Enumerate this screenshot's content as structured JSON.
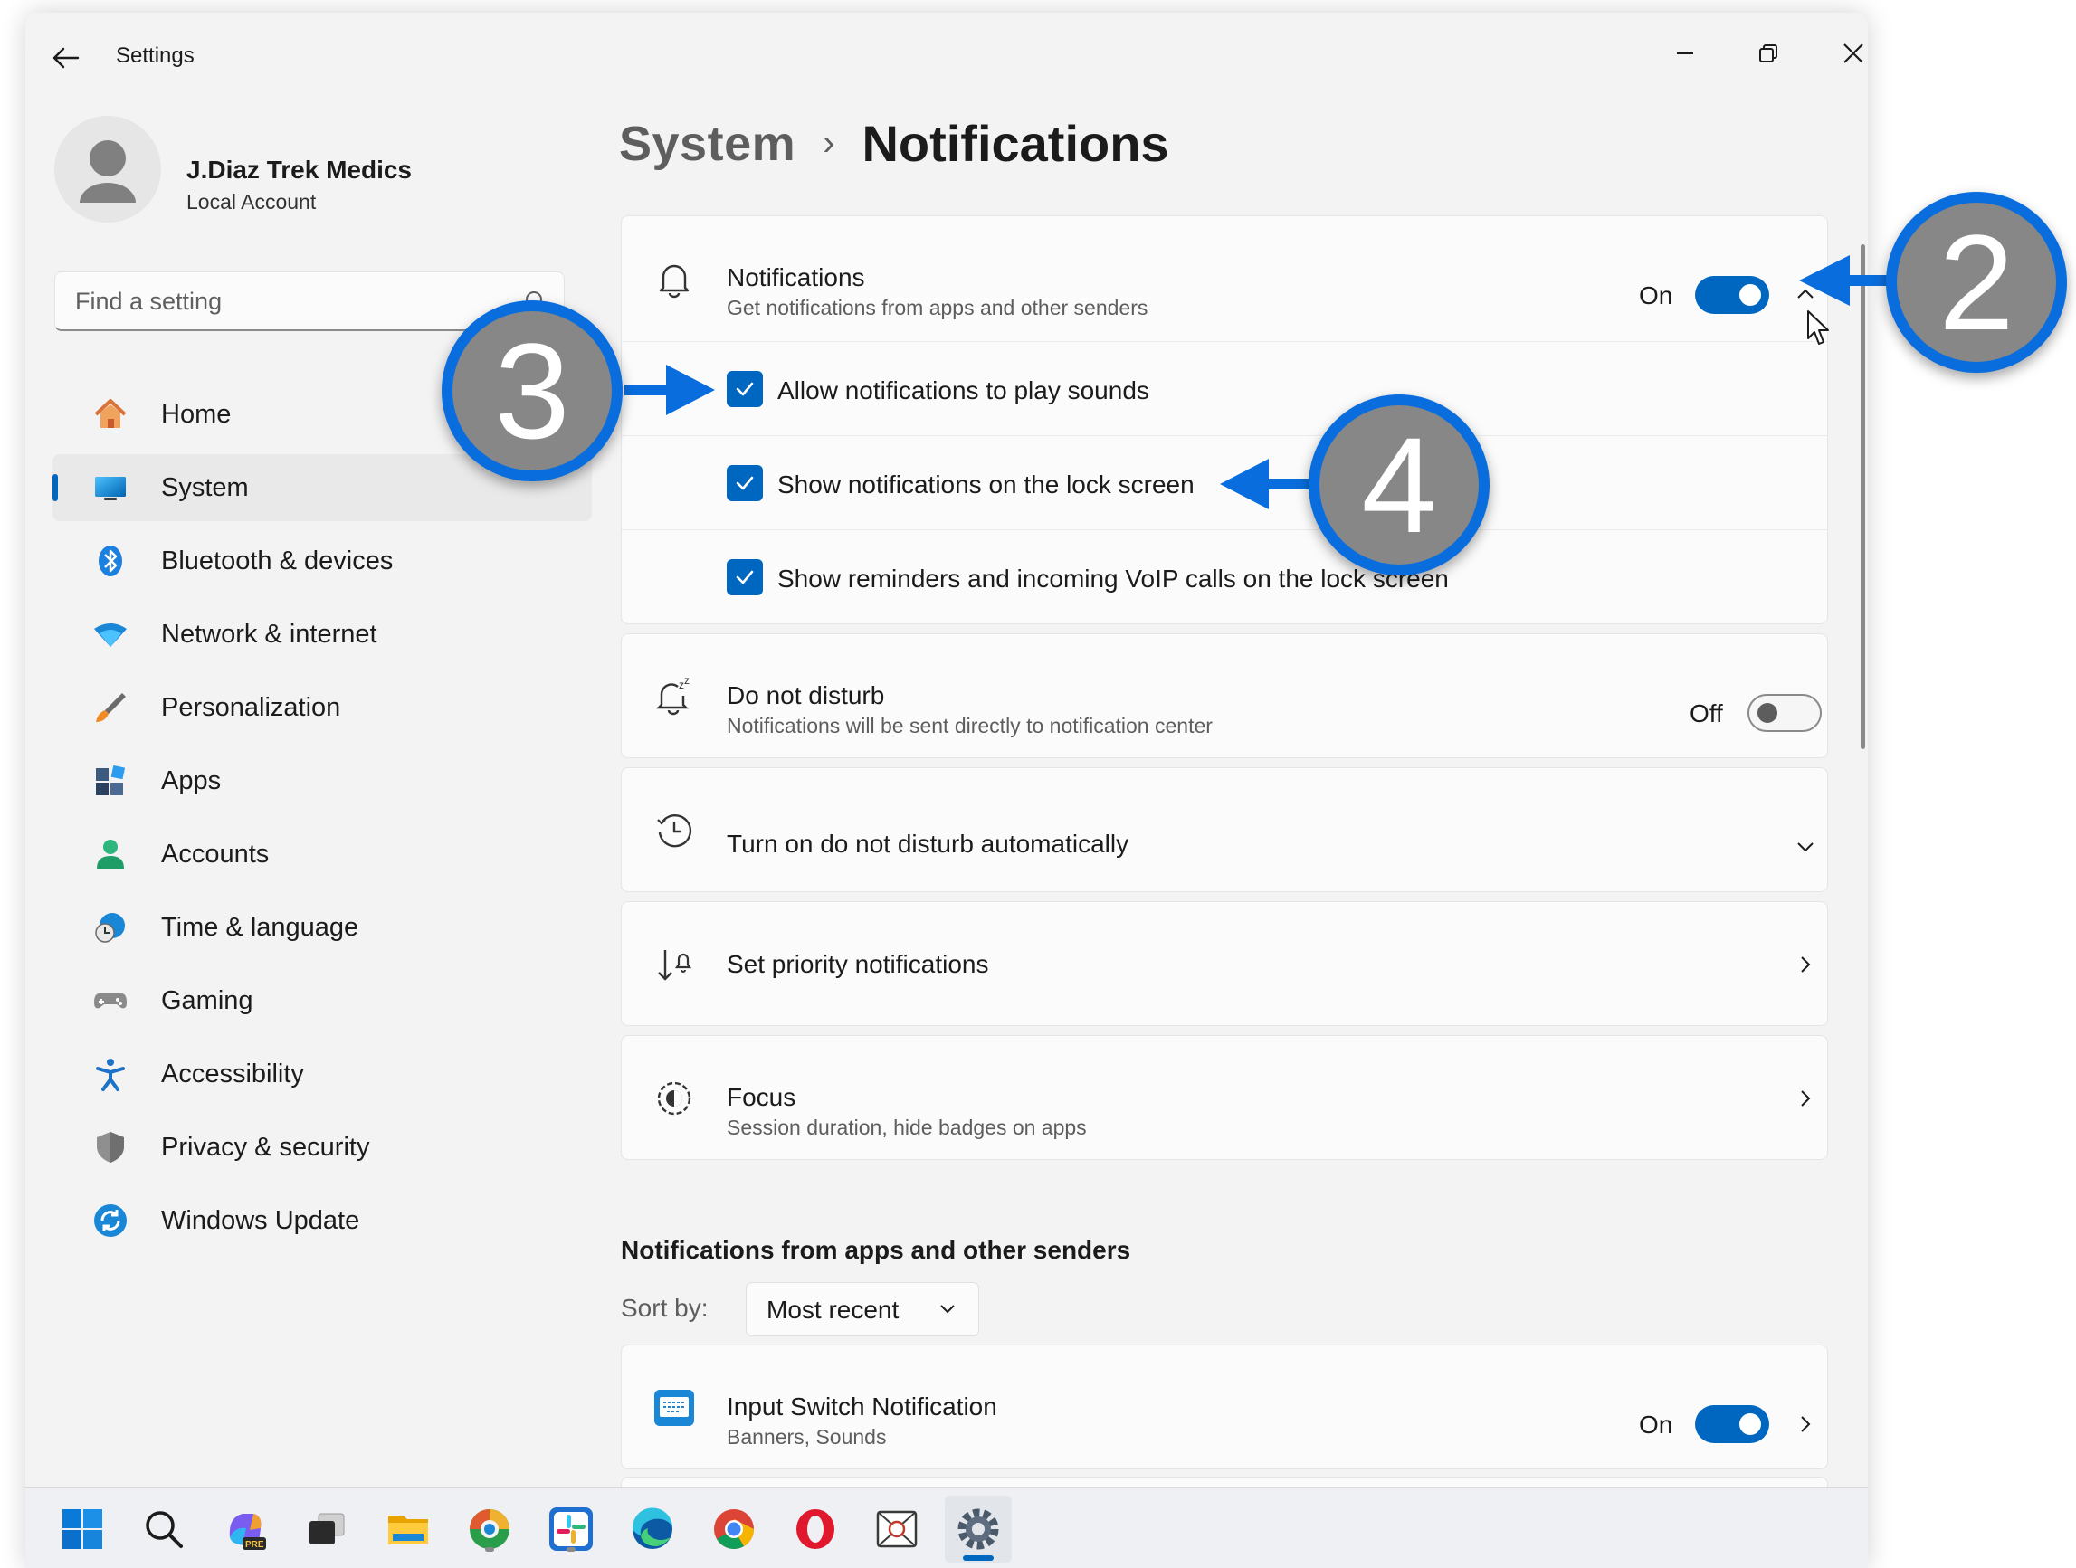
{
  "window": {
    "title": "Settings"
  },
  "profile": {
    "name": "J.Diaz Trek Medics",
    "account_type": "Local Account"
  },
  "search": {
    "placeholder": "Find a setting"
  },
  "sidebar": {
    "items": [
      {
        "label": "Home",
        "icon": "home-icon"
      },
      {
        "label": "System",
        "icon": "system-icon",
        "selected": true
      },
      {
        "label": "Bluetooth & devices",
        "icon": "bluetooth-icon"
      },
      {
        "label": "Network & internet",
        "icon": "wifi-icon"
      },
      {
        "label": "Personalization",
        "icon": "brush-icon"
      },
      {
        "label": "Apps",
        "icon": "apps-icon"
      },
      {
        "label": "Accounts",
        "icon": "accounts-icon"
      },
      {
        "label": "Time & language",
        "icon": "globe-clock-icon"
      },
      {
        "label": "Gaming",
        "icon": "gamepad-icon"
      },
      {
        "label": "Accessibility",
        "icon": "accessibility-icon"
      },
      {
        "label": "Privacy & security",
        "icon": "shield-icon"
      },
      {
        "label": "Windows Update",
        "icon": "update-icon"
      }
    ]
  },
  "breadcrumb": {
    "parent": "System",
    "separator": "›",
    "current": "Notifications"
  },
  "notifications": {
    "title": "Notifications",
    "subtitle": "Get notifications from apps and other senders",
    "state": "On",
    "options": [
      {
        "label": "Allow notifications to play sounds",
        "checked": true
      },
      {
        "label": "Show notifications on the lock screen",
        "checked": true
      },
      {
        "label": "Show reminders and incoming VoIP calls on the lock screen",
        "checked": true
      }
    ]
  },
  "dnd": {
    "title": "Do not disturb",
    "subtitle": "Notifications will be sent directly to notification center",
    "state": "Off"
  },
  "dnd_auto": {
    "title": "Turn on do not disturb automatically"
  },
  "priority": {
    "title": "Set priority notifications"
  },
  "focus": {
    "title": "Focus",
    "subtitle": "Session duration, hide badges on apps"
  },
  "apps_section": {
    "title": "Notifications from apps and other senders",
    "sort_label": "Sort by:",
    "sort_value": "Most recent"
  },
  "app_items": [
    {
      "title": "Input Switch Notification",
      "subtitle": "Banners, Sounds",
      "state": "On"
    }
  ],
  "annotations": [
    {
      "number": "2"
    },
    {
      "number": "3"
    },
    {
      "number": "4"
    }
  ],
  "taskbar": {
    "icons": [
      "start-icon",
      "search-icon",
      "copilot-icon",
      "task-view-icon",
      "file-explorer-icon",
      "edge-dev-icon",
      "slack-icon",
      "edge-icon",
      "chrome-icon",
      "opera-icon",
      "snipping-icon",
      "settings-icon"
    ]
  },
  "colors": {
    "accent": "#0067c0",
    "annotation_blue": "#0a6ddd",
    "annotation_gray": "#878787"
  }
}
